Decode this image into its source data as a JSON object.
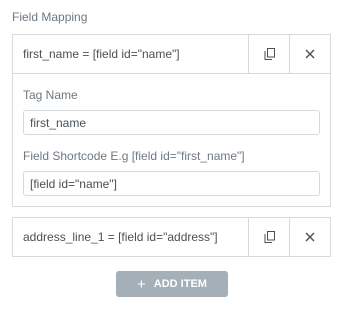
{
  "section": {
    "title": "Field Mapping"
  },
  "items": [
    {
      "title": "first_name = [field id=\"name\"]",
      "expanded": true,
      "tag_label": "Tag Name",
      "tag_value": "first_name",
      "shortcode_label": "Field Shortcode E.g [field id=\"first_name\"]",
      "shortcode_value": "[field id=\"name\"]"
    },
    {
      "title": "address_line_1 = [field id=\"address\"]",
      "expanded": false
    }
  ],
  "add_button": {
    "icon": "plus-icon",
    "label": "ADD ITEM"
  },
  "icons": {
    "duplicate": "copy-icon",
    "remove": "close-icon"
  },
  "colors": {
    "button_bg": "#a4afb7",
    "border": "#d5dadf",
    "label": "#6d7882"
  }
}
